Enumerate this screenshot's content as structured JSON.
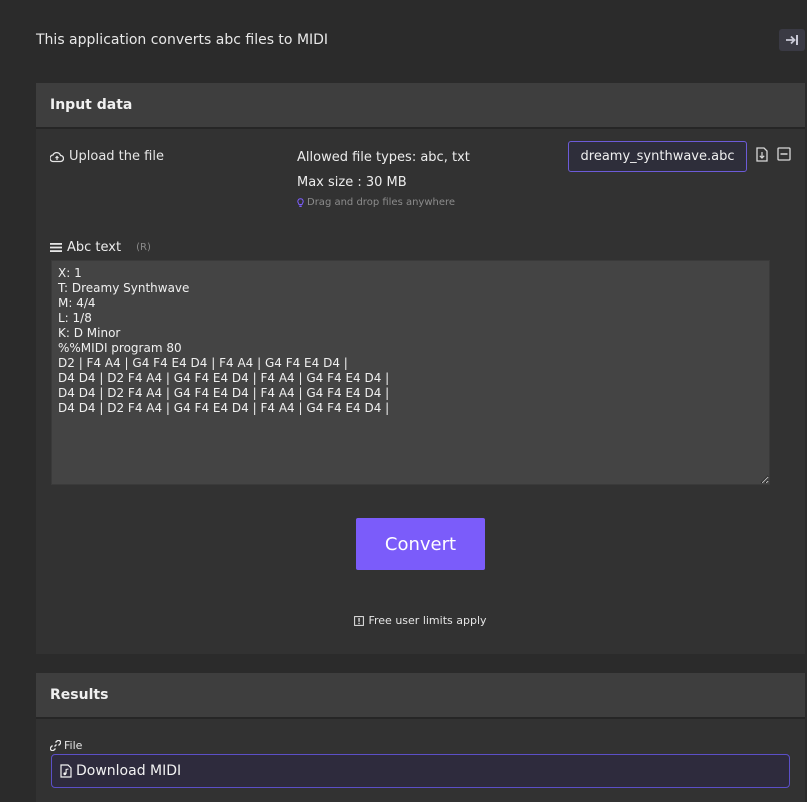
{
  "intro_text": "This application converts abc files to MIDI",
  "corner_button": {
    "icon": "arrow-to-right-icon"
  },
  "input_panel": {
    "title": "Input data",
    "upload_label": "Upload the file",
    "allowed_types": "Allowed file types: abc, txt",
    "max_size": "Max size : 30 MB",
    "drag_hint": "Drag and drop files anywhere",
    "filename": "dreamy_synthwave.abc",
    "abc_label": "Abc text",
    "abc_required": "(R)",
    "abc_text": "X: 1\nT: Dreamy Synthwave\nM: 4/4\nL: 1/8\nK: D Minor\n%%MIDI program 80\nD2 | F4 A4 | G4 F4 E4 D4 | F4 A4 | G4 F4 E4 D4 |\nD4 D4 | D2 F4 A4 | G4 F4 E4 D4 | F4 A4 | G4 F4 E4 D4 |\nD4 D4 | D2 F4 A4 | G4 F4 E4 D4 | F4 A4 | G4 F4 E4 D4 |\nD4 D4 | D2 F4 A4 | G4 F4 E4 D4 | F4 A4 | G4 F4 E4 D4 |",
    "convert_label": "Convert",
    "limits_text": "Free user limits apply"
  },
  "results_panel": {
    "title": "Results",
    "file_label": "File",
    "download_label": "Download MIDI"
  },
  "colors": {
    "accent": "#7b5cfa",
    "background": "#2b2b2b",
    "panel": "#323232"
  }
}
